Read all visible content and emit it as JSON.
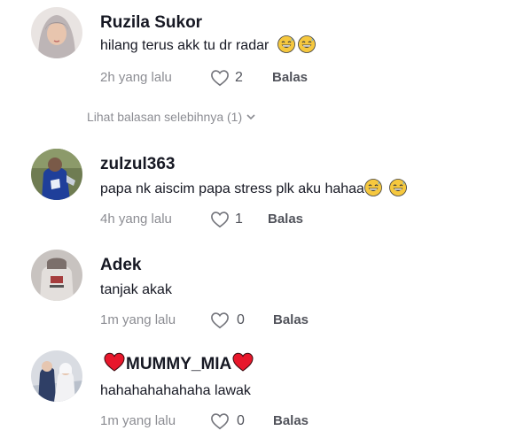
{
  "comments": [
    {
      "username": "Ruzila Sukor",
      "text": "hilang terus akk tu dr radar",
      "emojis": [
        "grinning-sweat-face",
        "grinning-sweat-face"
      ],
      "time": "2h yang lalu",
      "likes": "2",
      "reply": "Balas"
    },
    {
      "username": "zulzul363",
      "text": "papa nk aiscim papa stress plk aku hahaa",
      "emojis": [
        "grinning-sweat-face",
        "grinning-sweat-face"
      ],
      "time": "4h yang lalu",
      "likes": "1",
      "reply": "Balas"
    },
    {
      "username": "Adek",
      "text": "tanjak akak",
      "emojis": [],
      "time": "1m yang lalu",
      "likes": "0",
      "reply": "Balas"
    },
    {
      "username": "MUMMY_MIA",
      "username_decoration": "red-heart-emoji",
      "text": "hahahahahahaha lawak",
      "emojis": [],
      "time": "1m yang lalu",
      "likes": "0",
      "reply": "Balas"
    }
  ],
  "more_replies": {
    "label": "Lihat balasan selebihnya (1)",
    "icon": "chevron-down-icon"
  },
  "colors": {
    "text": "#161823",
    "muted": "rgba(22,24,35,0.5)",
    "heart": "#e8172b"
  }
}
